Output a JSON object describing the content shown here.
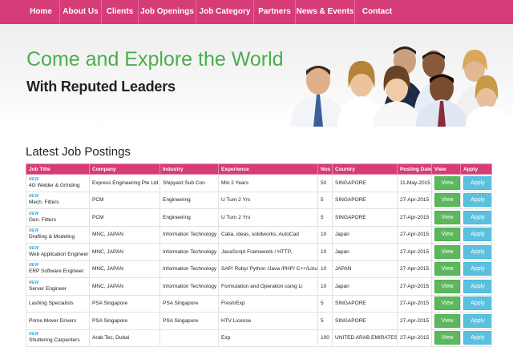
{
  "nav": [
    {
      "label": "Home"
    },
    {
      "label": "About Us"
    },
    {
      "label": "Clients"
    },
    {
      "label": "Job Openings"
    },
    {
      "label": "Job Category"
    },
    {
      "label": "Partners"
    },
    {
      "label": "News & Events"
    },
    {
      "label": "Contact"
    }
  ],
  "hero": {
    "title": "Come and Explore the World",
    "subtitle": "With Reputed Leaders"
  },
  "section": {
    "title": "Latest Job Postings"
  },
  "table": {
    "headers": [
      "Job Title",
      "Company",
      "Industry",
      "Experience",
      "Nos",
      "Country",
      "Posting Date",
      "View",
      "Apply"
    ],
    "new_label": "NEW",
    "view_label": "View",
    "apply_label": "Apply",
    "rows": [
      {
        "title": "4G Welder & Grinding",
        "company": "Express Engineering Pte Ltd",
        "industry": "Shipyard Sub Con",
        "experience": "Min 2 Years",
        "nos": "50",
        "country": "SINGAPORE",
        "date": "11-May-2015",
        "new": true
      },
      {
        "title": "Mech. Fitters",
        "company": "PCM",
        "industry": "Engineering",
        "experience": "U Turn 2 Yrs",
        "nos": "5",
        "country": "SINGAPORE",
        "date": "27-Apr-2015",
        "new": true
      },
      {
        "title": "Gen. Fitters",
        "company": "PCM",
        "industry": "Engineering",
        "experience": "U Turn 2 Yrs",
        "nos": "5",
        "country": "SINGAPORE",
        "date": "27-Apr-2015",
        "new": true
      },
      {
        "title": "Drafting & Modeling",
        "company": "MNC, JAPAN",
        "industry": "Information Technology",
        "experience": "Catia, ideas, solidworks, AutoCad",
        "nos": "10",
        "country": "Japan",
        "date": "27-Apr-2015",
        "new": true
      },
      {
        "title": "Web Application Engineer",
        "company": "MNC, JAPAN",
        "industry": "Information Technology",
        "experience": "JavaScript Framework / HTTP,",
        "nos": "10",
        "country": "Japan",
        "date": "27-Apr-2015",
        "new": true
      },
      {
        "title": "ERP Software Engineer",
        "company": "MNC, JAPAN",
        "industry": "Information Technology",
        "experience": "SAP/ Ruby/ Python /Java /PHP/ C++/Linux",
        "nos": "10",
        "country": "JAPAN",
        "date": "27-Apr-2015",
        "new": true
      },
      {
        "title": "Server Engineer",
        "company": "MNC, JAPAN",
        "industry": "Information Technology",
        "experience": "Formulation and Operation using Li",
        "nos": "10",
        "country": "Japan",
        "date": "27-Apr-2015",
        "new": true
      },
      {
        "title": "Lashing Specialists",
        "company": "PSA Singapore",
        "industry": "PSA Singapore",
        "experience": "Fresh/Exp",
        "nos": "5",
        "country": "SINGAPORE",
        "date": "27-Apr-2015",
        "new": false
      },
      {
        "title": "Prime Mover Drivers",
        "company": "PSA Singapore",
        "industry": "PSA Singapore",
        "experience": "HTV License",
        "nos": "5",
        "country": "SINGAPORE",
        "date": "27-Apr-2015",
        "new": false
      },
      {
        "title": "Shuttering Carpenters",
        "company": "Arab Tec, Dubai",
        "industry": "",
        "experience": "Exp",
        "nos": "100",
        "country": "UNITED ARAB EMIRATES",
        "date": "27-Apr-2015",
        "new": true
      }
    ]
  }
}
